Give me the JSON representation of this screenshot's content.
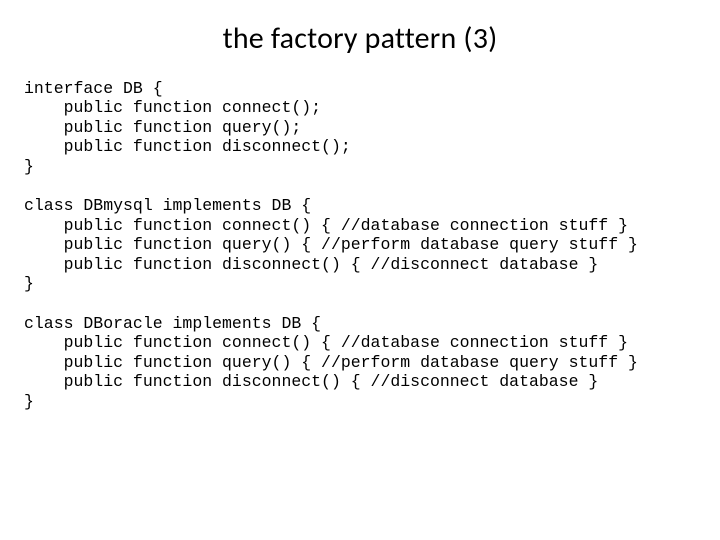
{
  "title": "the factory pattern (3)",
  "code": {
    "interface": "interface DB {\n    public function connect();\n    public function query();\n    public function disconnect();\n}",
    "mysql": "class DBmysql implements DB {\n    public function connect() { //database connection stuff }\n    public function query() { //perform database query stuff }\n    public function disconnect() { //disconnect database }\n}",
    "oracle": "class DBoracle implements DB {\n    public function connect() { //database connection stuff }\n    public function query() { //perform database query stuff }\n    public function disconnect() { //disconnect database }\n}"
  }
}
